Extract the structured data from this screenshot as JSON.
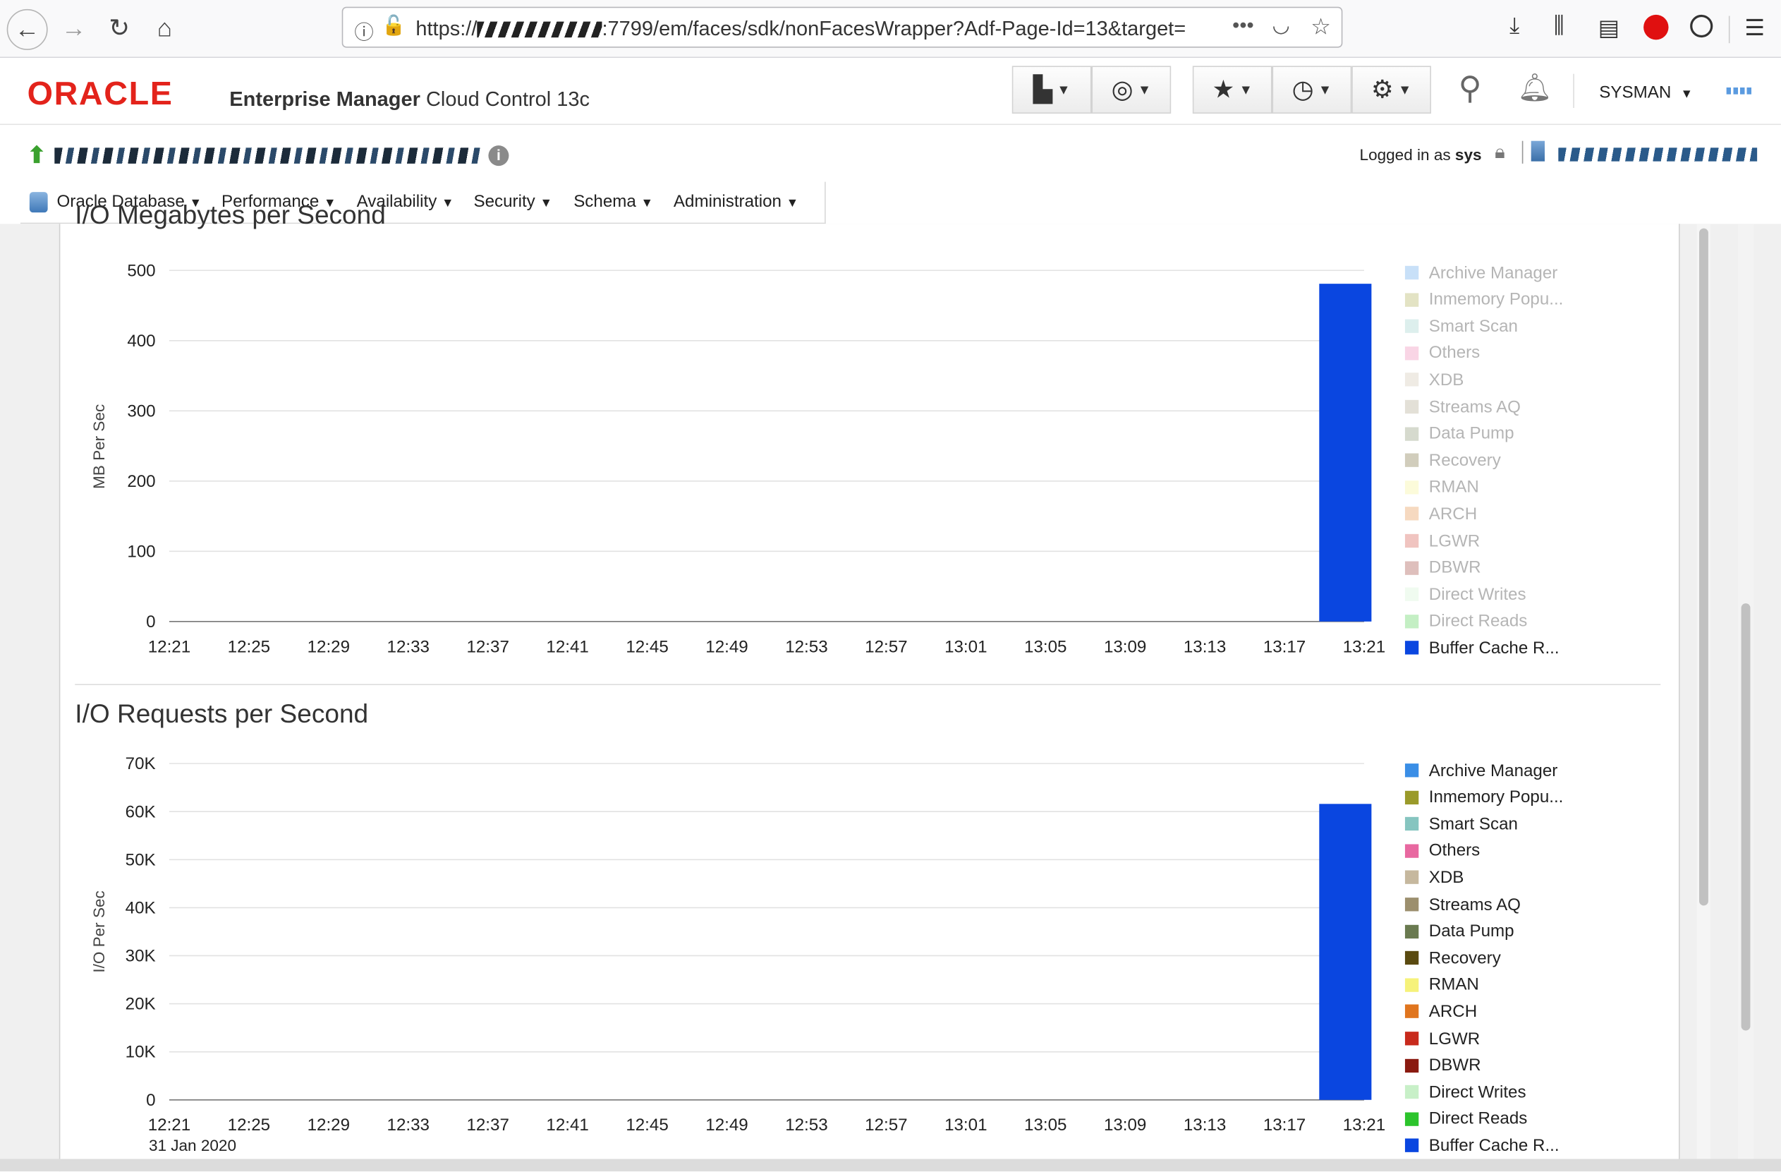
{
  "browser": {
    "url": "https://",
    "url_tail": ":7799/em/faces/sdk/nonFacesWrapper?Adf-Page-Id=13&target=",
    "more_label": "•••"
  },
  "header": {
    "logo": "ORACLE",
    "product": "Enterprise Manager",
    "product_sub": "Cloud Control 13c",
    "user": "SYSMAN"
  },
  "target": {
    "logged_in_label": "Logged in as",
    "logged_in_user": "sys"
  },
  "menu": {
    "items": [
      "Oracle Database",
      "Performance",
      "Availability",
      "Security",
      "Schema",
      "Administration"
    ]
  },
  "charts": {
    "mb": {
      "title": "I/O Megabytes per Second",
      "ylabel": "MB Per Sec",
      "yticks": [
        "500",
        "400",
        "300",
        "200",
        "100",
        "0"
      ],
      "xticks": [
        "12:21",
        "12:25",
        "12:29",
        "12:33",
        "12:37",
        "12:41",
        "12:45",
        "12:49",
        "12:53",
        "12:57",
        "13:01",
        "13:05",
        "13:09",
        "13:13",
        "13:17",
        "13:21"
      ]
    },
    "req": {
      "title": "I/O Requests per Second",
      "ylabel": "I/O Per Sec",
      "yticks": [
        "70K",
        "60K",
        "50K",
        "40K",
        "30K",
        "20K",
        "10K",
        "0"
      ],
      "xticks": [
        "12:21",
        "12:25",
        "12:29",
        "12:33",
        "12:37",
        "12:41",
        "12:45",
        "12:49",
        "12:53",
        "12:57",
        "13:01",
        "13:05",
        "13:09",
        "13:13",
        "13:17",
        "13:21"
      ],
      "date_label": "31 Jan 2020"
    },
    "legend": [
      {
        "name": "Archive Manager",
        "color": "#3a8ee6"
      },
      {
        "name": "Inmemory Popu...",
        "color": "#9a9a2a"
      },
      {
        "name": "Smart Scan",
        "color": "#86c5c0"
      },
      {
        "name": "Others",
        "color": "#e868a0"
      },
      {
        "name": "XDB",
        "color": "#c6b89e"
      },
      {
        "name": "Streams AQ",
        "color": "#9c8f6e"
      },
      {
        "name": "Data Pump",
        "color": "#6a7a50"
      },
      {
        "name": "Recovery",
        "color": "#5a4a10"
      },
      {
        "name": "RMAN",
        "color": "#f6f27a"
      },
      {
        "name": "ARCH",
        "color": "#e0751e"
      },
      {
        "name": "LGWR",
        "color": "#c82a1c"
      },
      {
        "name": "DBWR",
        "color": "#8a1a10"
      },
      {
        "name": "Direct Writes",
        "color": "#c8f0c8"
      },
      {
        "name": "Direct Reads",
        "color": "#2cc42c"
      },
      {
        "name": "Buffer Cache R...",
        "color": "#0a46e0"
      }
    ]
  },
  "chart_data": [
    {
      "type": "bar",
      "title": "I/O Megabytes per Second",
      "ylabel": "MB Per Sec",
      "ylim": [
        0,
        500
      ],
      "x": [
        "12:21",
        "12:25",
        "12:29",
        "12:33",
        "12:37",
        "12:41",
        "12:45",
        "12:49",
        "12:53",
        "12:57",
        "13:01",
        "13:05",
        "13:09",
        "13:13",
        "13:17",
        "13:21"
      ],
      "series": [
        {
          "name": "Buffer Cache R...",
          "color": "#0a46e0",
          "x": [
            "13:20"
          ],
          "values": [
            481
          ]
        }
      ],
      "grid": true,
      "legend_position": "right"
    },
    {
      "type": "bar",
      "title": "I/O Requests per Second",
      "ylabel": "I/O Per Sec",
      "ylim": [
        0,
        70000
      ],
      "x": [
        "12:21",
        "12:25",
        "12:29",
        "12:33",
        "12:37",
        "12:41",
        "12:45",
        "12:49",
        "12:53",
        "12:57",
        "13:01",
        "13:05",
        "13:09",
        "13:13",
        "13:17",
        "13:21"
      ],
      "series": [
        {
          "name": "Buffer Cache R...",
          "color": "#0a46e0",
          "x": [
            "13:20"
          ],
          "values": [
            61600
          ]
        }
      ],
      "grid": true,
      "legend_position": "right"
    }
  ]
}
